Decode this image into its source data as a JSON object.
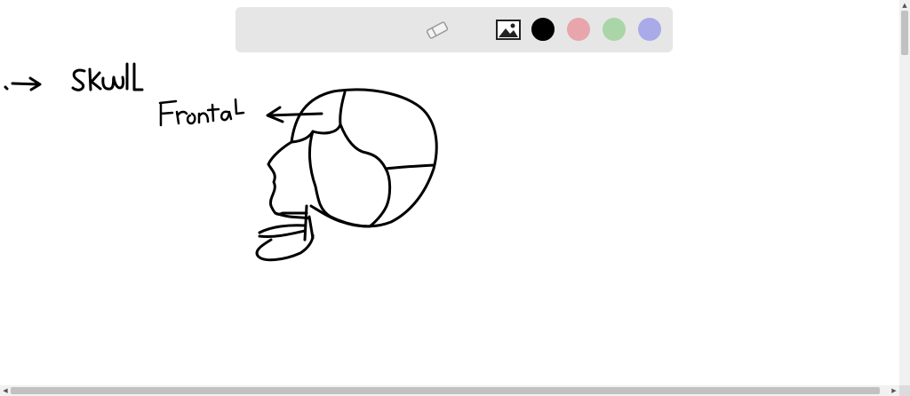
{
  "toolbar": {
    "tools": [
      "eraser-icon",
      "image-icon"
    ],
    "colors": [
      "#000000",
      "#e8a5ab",
      "#a9d5a7",
      "#a9aae8"
    ],
    "selected_color": "#000000"
  },
  "canvas": {
    "handwriting": [
      "SKull",
      "Frontal"
    ]
  }
}
